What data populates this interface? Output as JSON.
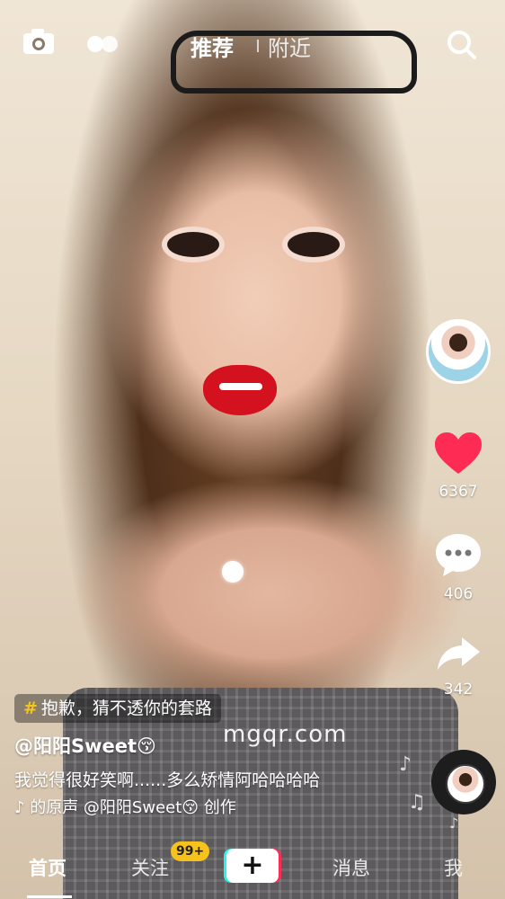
{
  "top_bar": {
    "tab_recommended": "推荐",
    "tab_nearby": "附近",
    "camera_icon": "camera-icon",
    "dual_dot_icon": "two-dots-icon",
    "search_icon": "search-icon"
  },
  "right_rail": {
    "like_count": "6367",
    "comment_count": "406",
    "share_count": "342",
    "like_color": "#fe2c55"
  },
  "video_info": {
    "hashtag": "抱歉，猜不透你的套路",
    "username": "@阳阳Sweet😚",
    "caption": "我觉得很好笑啊......多么矫情阿哈哈哈哈",
    "music": "♪ 的原声    @阳阳Sweet😚 创作"
  },
  "watermark": "mgqr.com",
  "bottom_nav": {
    "home": "首页",
    "following": "关注",
    "following_badge": "99+",
    "create": "+",
    "messages": "消息",
    "me": "我"
  }
}
